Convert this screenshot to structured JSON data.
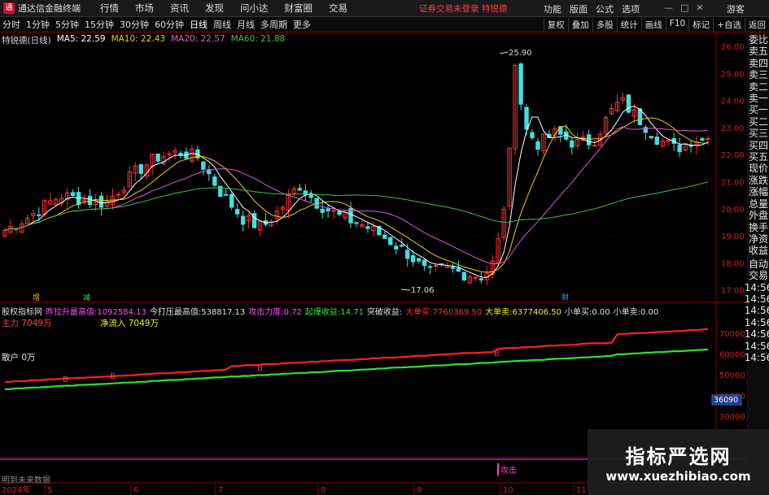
{
  "menubar": {
    "logo": "通",
    "title": "通达信金融终端",
    "items": [
      "行情",
      "市场",
      "资讯",
      "发现",
      "问小达",
      "财富圈",
      "交易"
    ],
    "promo": "证券交易未登录  特锐德",
    "right": [
      "功能",
      "版面",
      "公式",
      "选项",
      "游客"
    ],
    "win_btns": [
      "—",
      "□",
      "✕"
    ]
  },
  "toolbar": {
    "periods": [
      "分时",
      "1分钟",
      "5分钟",
      "15分钟",
      "30分钟",
      "60分钟",
      "日线",
      "周线",
      "月线",
      "多周期",
      "更多"
    ],
    "right": [
      "复权",
      "叠加",
      "多股",
      "统计",
      "画线",
      "F10",
      "标记",
      "+自选",
      "返回"
    ]
  },
  "legend": {
    "name": "特锐德(日线)",
    "ma5": "MA5: 22.59",
    "ma10": "MA10: 22.43",
    "ma20": "MA20: 22.57",
    "ma60": "MA60: 21.88",
    "colors": {
      "ma5": "#ffffff",
      "ma10": "#f0d000",
      "ma20": "#d060d0",
      "ma60": "#40c040"
    }
  },
  "price_axis": {
    "ticks": [
      "26.00",
      "25.00",
      "24.00",
      "23.00",
      "22.00",
      "21.00",
      "20.00",
      "19.00",
      "18.00",
      "17.00"
    ]
  },
  "annotations": {
    "high": "25.90",
    "low": "17.06",
    "tag1": "增",
    "tag2": "减",
    "tag3": "财"
  },
  "indicator": {
    "name": "股权指标网",
    "items": [
      {
        "label": "昨拉升最高值:",
        "value": "1092584.13",
        "color": "#ff50ff"
      },
      {
        "label": "今打压最高值:",
        "value": "538817.13",
        "color": "#e0e0e0"
      },
      {
        "label": "攻击力度:",
        "value": "0.72",
        "color": "#ff50ff"
      },
      {
        "label": "起爆收益:",
        "value": "14.71",
        "color": "#40e040"
      },
      {
        "label": "突破收益:",
        "value": "",
        "color": "#e0e0e0"
      },
      {
        "label": "大单买:",
        "value": "7760369.50",
        "color": "#ff3030"
      },
      {
        "label": "大单卖:",
        "value": "6377406.50",
        "color": "#f0f000"
      },
      {
        "label": "小单买:",
        "value": "0.00",
        "color": "#e0e0e0"
      },
      {
        "label": "小单卖:",
        "value": "0.00",
        "color": "#e0e0e0"
      }
    ],
    "main_force": "主力 7049万",
    "net_inflow": "净流入 7049万",
    "retail": "散户 0万",
    "axis_ticks": [
      "70000",
      "60000",
      "50000",
      "40000",
      "30000"
    ],
    "current_tag": "36090",
    "b_marks": [
      "B",
      "B",
      "B",
      "B"
    ]
  },
  "bottom": {
    "label": "明到未来数据",
    "attack": "攻击"
  },
  "date_axis": {
    "labels": [
      "2024年",
      "5",
      "6",
      "7",
      "8",
      "9",
      "10",
      "11"
    ]
  },
  "side_panel": {
    "items": [
      "委比",
      "卖五",
      "卖四",
      "卖三",
      "卖二",
      "卖一",
      "买一",
      "买二",
      "买三",
      "买四",
      "买五",
      "现价",
      "涨跌",
      "涨幅",
      "总量",
      "外盘",
      "换手",
      "净资",
      "收益",
      "自动",
      "交易",
      "14:56",
      "14:56",
      "14:56",
      "14:56",
      "14:56",
      "14:56",
      "14:56"
    ]
  },
  "watermark": {
    "title": "指标严选网",
    "url": "www.xuezhibiao.com"
  }
}
